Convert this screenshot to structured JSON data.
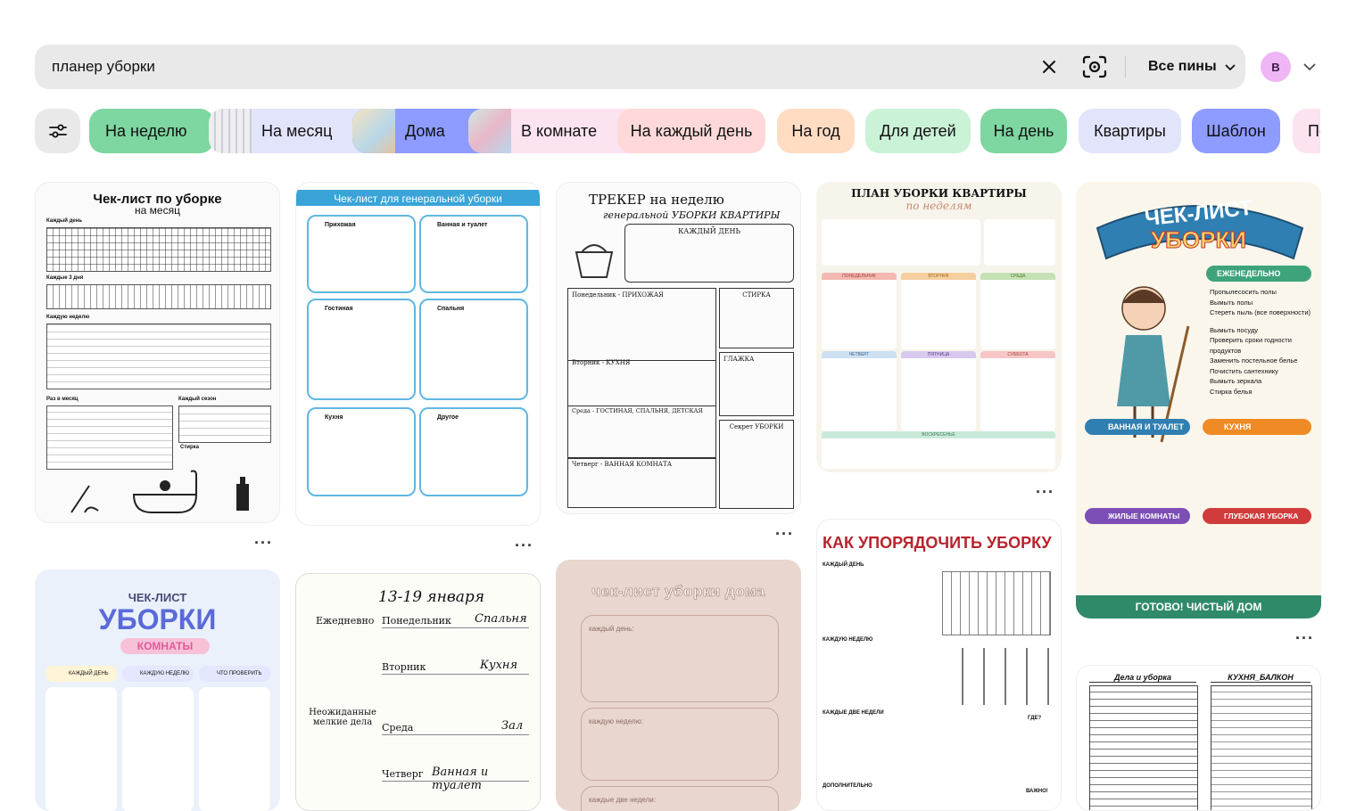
{
  "search": {
    "value": "планер уборки"
  },
  "header": {
    "all_pins_label": "Все пины",
    "avatar_letter": "B"
  },
  "colors": {
    "search_bg": "#e9e9e9",
    "avatar_bg": "#f0b5f5"
  },
  "chips": [
    {
      "label": "На неделю",
      "color": "#7ed6a1"
    },
    {
      "label": "На месяц",
      "color": "#e2e4fb"
    },
    {
      "label": "Дома",
      "color": "#8e9bff"
    },
    {
      "label": "В комнате",
      "color": "#fbe3f0"
    },
    {
      "label": "На каждый день",
      "color": "#ffd9d9"
    },
    {
      "label": "На год",
      "color": "#ffdcc2"
    },
    {
      "label": "Для детей",
      "color": "#c9f2d6"
    },
    {
      "label": "На день",
      "color": "#7ed6a1"
    },
    {
      "label": "Квартиры",
      "color": "#e2e4fb"
    },
    {
      "label": "Шаблон",
      "color": "#8e9bff"
    },
    {
      "label": "По",
      "color": "#fbe3f0"
    }
  ],
  "pins": {
    "p1": {
      "title": "Чек-лист по уборке",
      "subtitle": "на месяц",
      "sections": [
        "Каждый день",
        "Каждые 3 дня",
        "Каждую неделю",
        "Раз в месяц",
        "Каждый сезон",
        "Стирка"
      ]
    },
    "p2": {
      "title": "Чек-лист для генеральной уборки",
      "sections": [
        "Прихожая",
        "Ванная и туалет",
        "Гостиная",
        "Спальня",
        "Кухня",
        "Другое"
      ]
    },
    "p3": {
      "title": "ТРЕКЕР на неделю",
      "subtitle": "генеральной УБОРКИ КВАРТИРЫ",
      "sections": [
        "КАЖДЫЙ ДЕНЬ",
        "Понедельник - ПРИХОЖАЯ",
        "СТИРКА",
        "Вторник - КУХНЯ",
        "ГЛАЖКА",
        "Среда - ГОСТИНАЯ, СПАЛЬНЯ, ДЕТСКАЯ",
        "Четверг - ВАННАЯ КОМНАТА",
        "Секрет УБОРКИ"
      ]
    },
    "p4": {
      "title": "ПЛАН УБОРКИ КВАРТИРЫ",
      "subtitle": "по неделям",
      "sections": [
        "ПОНЕДЕЛЬНИК",
        "ВТОРНИК",
        "СРЕДА",
        "ЧЕТВЕРГ",
        "ПЯТНИЦА",
        "СУББОТА",
        "ВОСКРЕСЕНЬЕ"
      ]
    },
    "p5": {
      "title_line1": "ЧЕК-ЛИСТ",
      "title_line2": "УБОРКИ",
      "sections": [
        "ЕЖЕНЕДЕЛЬНО",
        "ВАННАЯ И ТУАЛЕТ",
        "КУХНЯ",
        "ЖИЛЫЕ КОМНАТЫ",
        "ГЛУБОКАЯ УБОРКА"
      ],
      "items": [
        "Пропылесосить полы",
        "Вымыть полы",
        "Стереть пыль (все поверхности)",
        "Вымыть посуду",
        "Проверить сроки годности продуктов",
        "Заменить постельное белье",
        "Почистить сантехнику",
        "Вымыть зеркала",
        "Стирка белья"
      ],
      "footer": "ГОТОВО! ЧИСТЫЙ ДОМ"
    },
    "p6": {
      "title_line1": "ЧЕК-ЛИСТ",
      "title_line2": "УБОРКИ",
      "subtitle": "КОМНАТЫ",
      "sections": [
        "КАЖДЫЙ ДЕНЬ",
        "КАЖДУЮ НЕДЕЛЮ",
        "ЧТО ПРОВЕРИТЬ"
      ]
    },
    "p7": {
      "date": "13-19 января",
      "sections": [
        "Ежедневно",
        "Понедельник",
        "Спальня",
        "Вторник",
        "Кухня",
        "Неожиданные мелкие дела",
        "Среда",
        "Зал",
        "Четверг",
        "Ванная и туалет"
      ]
    },
    "p8": {
      "title": "чек-лист уборки дома",
      "sections": [
        "каждый день:",
        "каждую неделю:",
        "каждые две недели:"
      ]
    },
    "p9": {
      "title": "КАК УПОРЯДОЧИТЬ УБОРКУ",
      "sections": [
        "КАЖДЫЙ ДЕНЬ",
        "КАЖДУЮ НЕДЕЛЮ",
        "КАЖДЫЕ ДВЕ НЕДЕЛИ",
        "ДОПОЛНИТЕЛЬНО",
        "ГДЕ?",
        "ВАЖНО!"
      ]
    },
    "p10": {
      "left_title": "Дела и уборка",
      "right_title": "КУХНЯ_БАЛКОН"
    }
  }
}
